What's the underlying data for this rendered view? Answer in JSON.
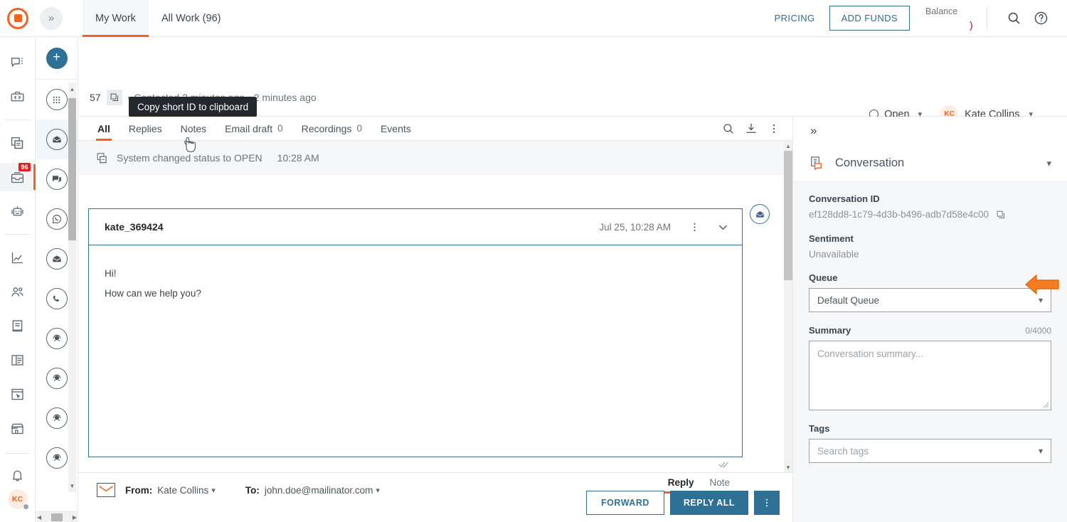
{
  "topbar": {
    "logo_icon": "brand-logo-icon",
    "expand_icon": "chevron-double-right-icon",
    "tabs": [
      {
        "label": "My Work",
        "active": true
      },
      {
        "label": "All Work (96)",
        "active": false
      }
    ],
    "pricing_label": "PRICING",
    "add_funds_label": "ADD FUNDS",
    "balance_label": "Balance",
    "balance_value": ")",
    "search_icon": "search-icon",
    "help_icon": "help-circle-icon"
  },
  "rail": {
    "items": [
      {
        "name": "messages",
        "icon": "chat-bubble-menu-icon"
      },
      {
        "name": "developer",
        "icon": "code-briefcase-icon"
      },
      {
        "name": "knowledge",
        "icon": "document-reply-icon"
      },
      {
        "name": "inbox",
        "icon": "inbox-tray-icon",
        "badge": "96",
        "selected": true
      },
      {
        "name": "bots",
        "icon": "robot-icon"
      },
      {
        "name": "analytics",
        "icon": "line-chart-icon"
      },
      {
        "name": "teams",
        "icon": "people-icon"
      },
      {
        "name": "library",
        "icon": "book-icon"
      },
      {
        "name": "reports",
        "icon": "report-panel-icon"
      },
      {
        "name": "widgets",
        "icon": "widget-cursor-icon"
      },
      {
        "name": "marketplace",
        "icon": "storefront-icon"
      }
    ],
    "notification_icon": "bell-icon",
    "avatar_initials": "KC"
  },
  "channel_rail": {
    "add_icon": "plus-icon",
    "items": [
      {
        "name": "all-channels",
        "icon": "grid-dots-icon"
      },
      {
        "name": "email-inbox",
        "icon": "email-icon",
        "selected": true
      },
      {
        "name": "chat",
        "icon": "chat-icon"
      },
      {
        "name": "whatsapp",
        "icon": "whatsapp-icon"
      },
      {
        "name": "email-secondary",
        "icon": "email-icon"
      },
      {
        "name": "voice",
        "icon": "phone-icon"
      },
      {
        "name": "support-1",
        "icon": "headset-icon"
      },
      {
        "name": "support-2",
        "icon": "headset-icon"
      },
      {
        "name": "support-3",
        "icon": "headset-icon"
      },
      {
        "name": "support-4",
        "icon": "headset-icon"
      }
    ]
  },
  "conversation_header": {
    "tooltip": "Copy short ID to clipboard",
    "short_id": "57",
    "copy_icon": "copy-icon",
    "meta": "• Contacted 2 minutes ago • 2 minutes ago",
    "status": "Open",
    "status_icon": "circle-outline-icon",
    "assignee_initials": "KC",
    "assignee_name": "Kate Collins"
  },
  "message_pane": {
    "tabs": [
      {
        "label": "All",
        "count": "",
        "active": true
      },
      {
        "label": "Replies",
        "count": "",
        "active": false
      },
      {
        "label": "Notes",
        "count": "",
        "active": false
      },
      {
        "label": "Email draft",
        "count": "0",
        "active": false
      },
      {
        "label": "Recordings",
        "count": "0",
        "active": false
      },
      {
        "label": "Events",
        "count": "",
        "active": false
      }
    ],
    "actions": [
      {
        "name": "search-messages",
        "icon": "search-icon"
      },
      {
        "name": "download-transcript",
        "icon": "download-icon"
      },
      {
        "name": "more-options",
        "icon": "kebab-menu-icon"
      }
    ],
    "system_event": {
      "icon": "status-change-icon",
      "text": "System changed status to OPEN",
      "time": "10:28 AM"
    },
    "message": {
      "from": "kate_369424",
      "date": "Jul 25, 10:28 AM",
      "kebab_icon": "kebab-menu-icon",
      "collapse_icon": "chevron-down-icon",
      "avatar_icon": "email-icon",
      "body_lines": [
        "Hi!",
        "How can we help you?"
      ],
      "read_receipt_icon": "double-check-icon"
    }
  },
  "composer": {
    "envelope_icon": "envelope-icon",
    "from_label": "From:",
    "from_value": "Kate Collins",
    "to_label": "To:",
    "to_value": "john.doe@mailinator.com",
    "mode_tabs": [
      {
        "label": "Reply",
        "active": true
      },
      {
        "label": "Note",
        "active": false
      }
    ],
    "forward_label": "FORWARD",
    "reply_all_label": "REPLY ALL",
    "more_icon": "kebab-menu-icon"
  },
  "right_panel": {
    "collapse_icon": "chevron-double-right-icon",
    "section_icon": "conversation-doc-icon",
    "section_title": "Conversation",
    "section_chevron": "chevron-down-icon",
    "conversation_id_label": "Conversation ID",
    "conversation_id_value": "ef128dd8-1c79-4d3b-b496-adb7d58e4c00",
    "copy_icon": "copy-icon",
    "annotation_icon": "left-arrow-annotation",
    "sentiment_label": "Sentiment",
    "sentiment_value": "Unavailable",
    "queue_label": "Queue",
    "queue_value": "Default Queue",
    "summary_label": "Summary",
    "summary_counter": "0/4000",
    "summary_placeholder": "Conversation summary...",
    "tags_label": "Tags",
    "tags_placeholder": "Search tags"
  },
  "colors": {
    "brand_orange": "#f26322",
    "teal": "#2e7096",
    "badge_red": "#e02020"
  }
}
